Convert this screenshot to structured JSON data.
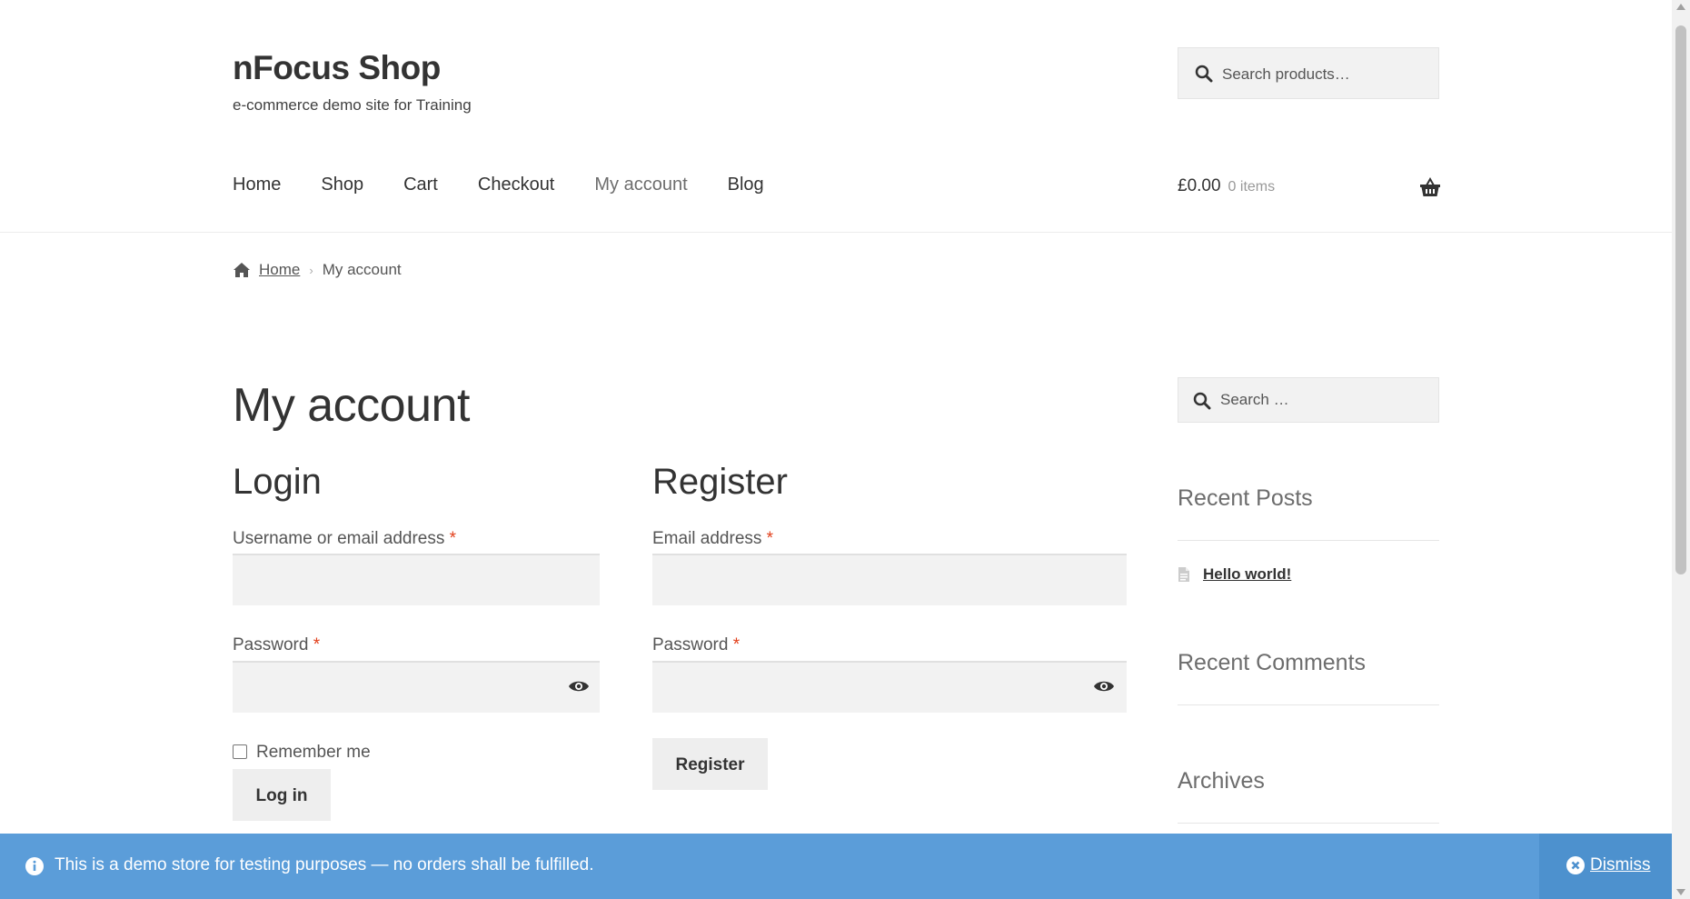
{
  "site": {
    "title": "nFocus Shop",
    "tagline": "e-commerce demo site for Training"
  },
  "header_search": {
    "placeholder": "Search products…"
  },
  "nav": {
    "items": [
      "Home",
      "Shop",
      "Cart",
      "Checkout",
      "My account",
      "Blog"
    ],
    "current": "My account"
  },
  "cart": {
    "total": "£0.00",
    "items": "0 items",
    "icon": "basket-icon"
  },
  "breadcrumb": {
    "home": "Home",
    "current": "My account"
  },
  "page_title": "My account",
  "login": {
    "heading": "Login",
    "username_label": "Username or email address",
    "password_label": "Password",
    "remember_label": "Remember me",
    "submit_label": "Log in",
    "required_mark": "*"
  },
  "register": {
    "heading": "Register",
    "email_label": "Email address",
    "password_label": "Password",
    "submit_label": "Register",
    "required_mark": "*"
  },
  "sidebar": {
    "search_placeholder": "Search …",
    "recent_posts_title": "Recent Posts",
    "recent_posts": [
      "Hello world!"
    ],
    "recent_comments_title": "Recent Comments",
    "archives_title": "Archives"
  },
  "store_notice": {
    "message": "This is a demo store for testing purposes — no orders shall be fulfilled.",
    "dismiss_label": "Dismiss",
    "bg_color": "#5b9dd9"
  },
  "colors": {
    "required": "#e2401c",
    "text": "#404040",
    "field_bg": "#f2f2f2"
  }
}
